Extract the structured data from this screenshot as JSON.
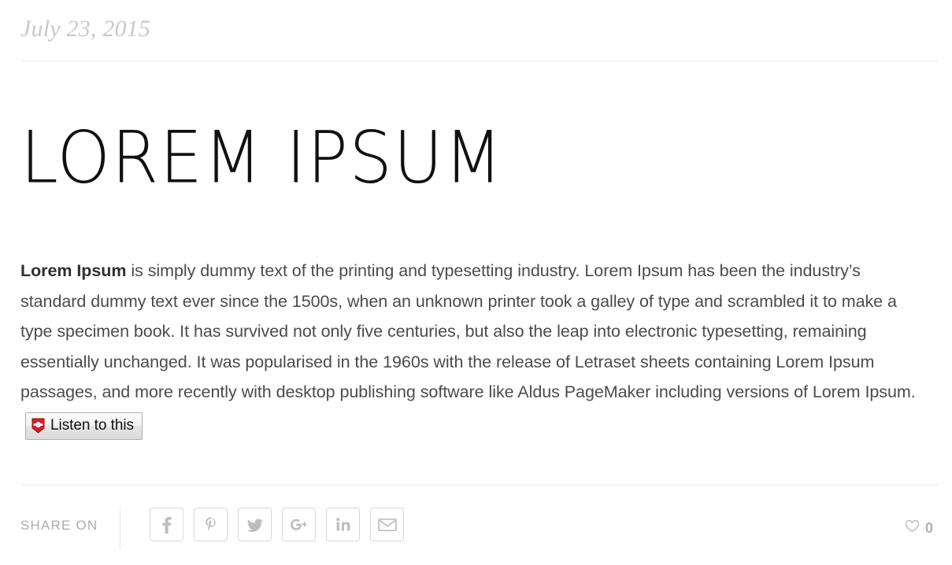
{
  "article": {
    "date": "July 23, 2015",
    "title": "LOREM IPSUM",
    "body": {
      "lead": "Lorem Ipsum",
      "text": " is simply dummy text of the printing and typesetting industry. Lorem Ipsum has been the industry’s standard dummy text ever since the 1500s, when an unknown printer took a galley of type and scrambled it to make a type specimen book. It has survived not only five centuries, but also the leap into electronic typesetting, remaining essentially unchanged. It was popularised in the 1960s with the release of Letraset sheets containing Lorem Ipsum passages, and more recently with desktop publishing software like Aldus PageMaker including versions of Lorem Ipsum."
    },
    "listen_button": {
      "label": "Listen to this",
      "icon": "readspeaker-shield-icon",
      "icon_color": "#d81f26"
    }
  },
  "footer": {
    "share_label": "SHARE ON",
    "social": [
      {
        "name": "facebook",
        "icon": "facebook-icon",
        "label": "f"
      },
      {
        "name": "pinterest",
        "icon": "pinterest-icon",
        "label": "p"
      },
      {
        "name": "twitter",
        "icon": "twitter-icon",
        "label": "twitter bird"
      },
      {
        "name": "googleplus",
        "icon": "google-plus-icon",
        "label": "g+"
      },
      {
        "name": "linkedin",
        "icon": "linkedin-icon",
        "label": "in"
      },
      {
        "name": "email",
        "icon": "envelope-icon",
        "label": "envelope"
      }
    ],
    "likes": {
      "icon": "heart-icon",
      "count": "0"
    }
  },
  "colors": {
    "background": "#ffffff",
    "text": "#4b4b4b",
    "title": "#101010",
    "date": "#c9c9c9",
    "rule": "#ebebeb",
    "muted": "#bdbdbd",
    "accent_red": "#d81f26"
  }
}
